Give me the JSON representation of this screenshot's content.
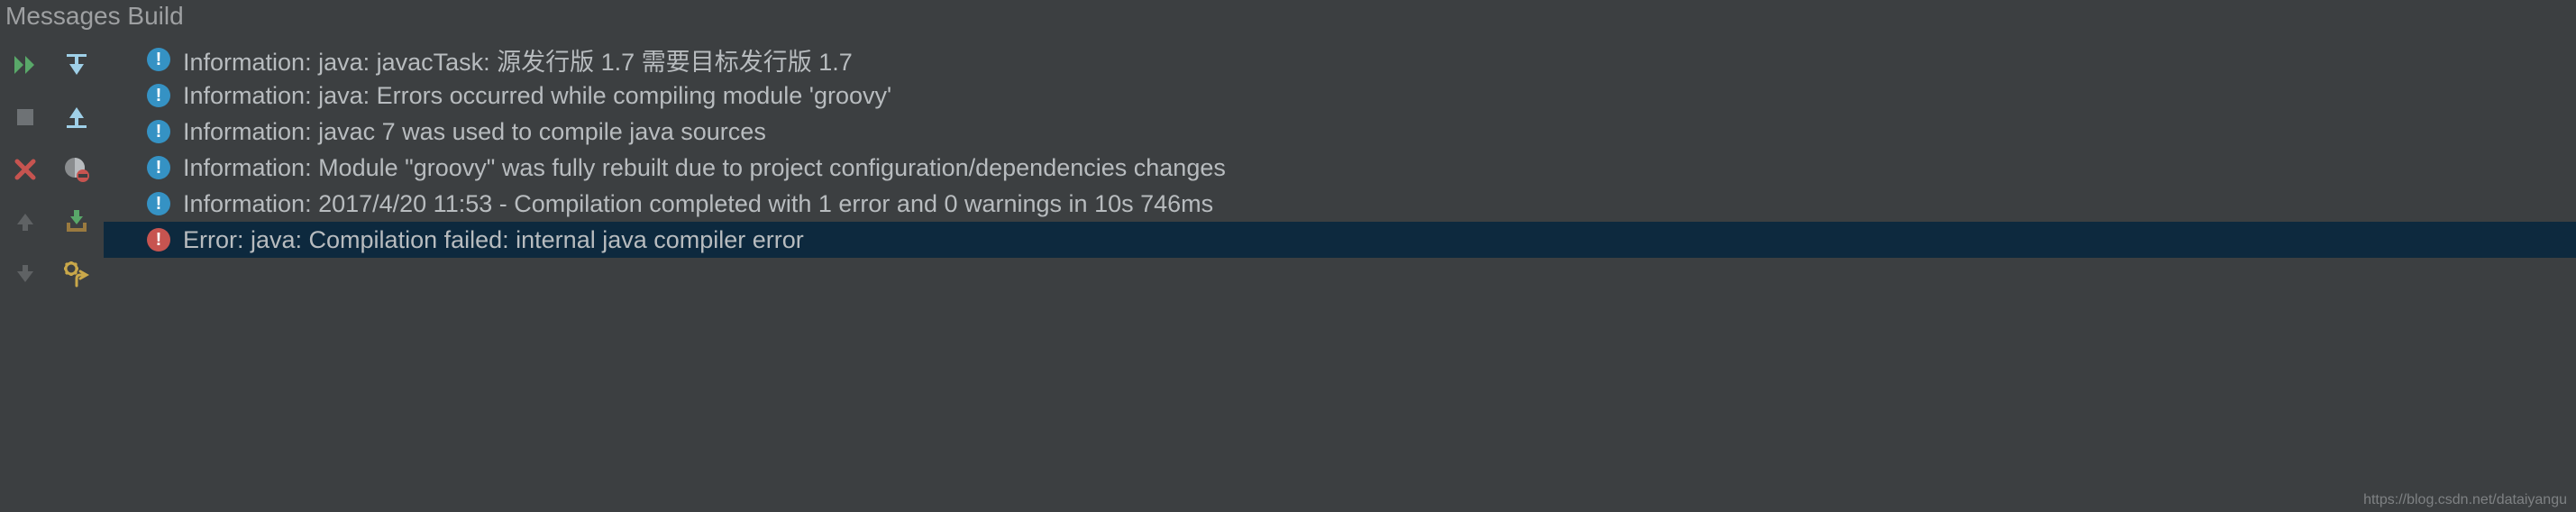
{
  "panel": {
    "title": "Messages Build"
  },
  "messages": [
    {
      "type": "info",
      "text": "Information: java: javacTask: 源发行版 1.7 需要目标发行版 1.7",
      "selected": false
    },
    {
      "type": "info",
      "text": "Information: java: Errors occurred while compiling module 'groovy'",
      "selected": false
    },
    {
      "type": "info",
      "text": "Information: javac 7 was used to compile java sources",
      "selected": false
    },
    {
      "type": "info",
      "text": "Information: Module \"groovy\" was fully rebuilt due to project configuration/dependencies changes",
      "selected": false
    },
    {
      "type": "info",
      "text": "Information: 2017/4/20 11:53 - Compilation completed with 1 error and 0 warnings in 10s 746ms",
      "selected": false
    },
    {
      "type": "error",
      "text": "Error: java: Compilation failed: internal java compiler error",
      "selected": true
    }
  ],
  "watermark": "https://blog.csdn.net/dataiyangu"
}
